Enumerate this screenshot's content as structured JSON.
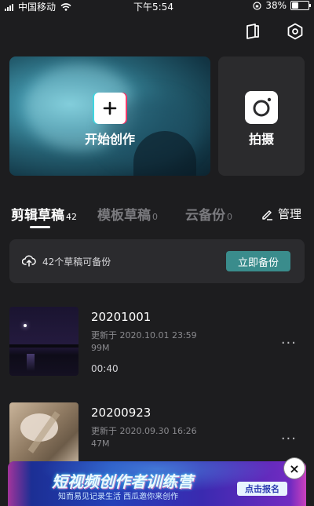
{
  "status_bar": {
    "carrier": "中国移动",
    "time": "下午5:54",
    "battery": "38%",
    "battery_level": 0.38
  },
  "top_icons": [
    "book-icon",
    "settings-hexagon-icon"
  ],
  "cards": {
    "create_label": "开始创作",
    "shoot_label": "拍摄"
  },
  "tabs": [
    {
      "label": "剪辑草稿",
      "count": "42",
      "active": true
    },
    {
      "label": "模板草稿",
      "count": "0",
      "active": false
    },
    {
      "label": "云备份",
      "count": "0",
      "active": false
    }
  ],
  "manage_label": "管理",
  "backup": {
    "text": "42个草稿可备份",
    "button": "立即备份"
  },
  "drafts": [
    {
      "name": "20201001",
      "updated": "更新于 2020.10.01 23:59",
      "size": "99M",
      "duration": "00:40"
    },
    {
      "name": "20200923",
      "updated": "更新于 2020.09.30 16:26",
      "size": "47M",
      "duration": ""
    }
  ],
  "more_label": "···",
  "banner": {
    "title": "短视频创作者训练营",
    "subtitle": "知而易见记录生活 西瓜邀你来创作",
    "cta": "点击报名",
    "close": "×"
  },
  "colors": {
    "background": "#1d1d1f",
    "card": "#2b2b2e",
    "accent_button": "#3a8c8c"
  }
}
